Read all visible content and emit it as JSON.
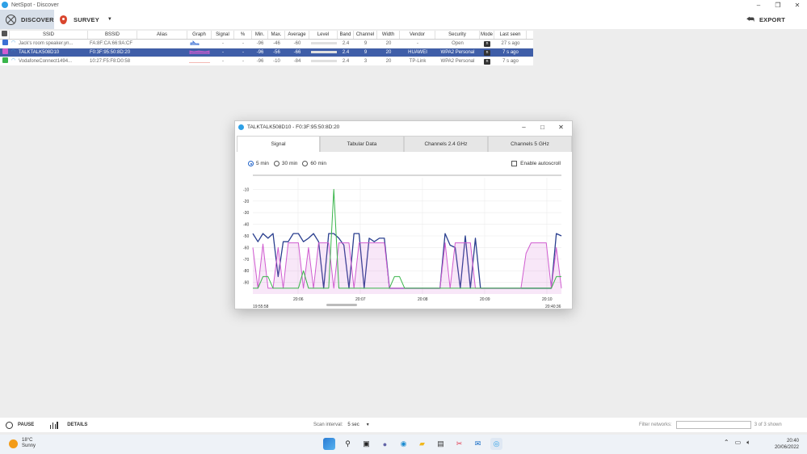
{
  "window": {
    "title": "NetSpot - Discover",
    "controls": [
      "–",
      "❐",
      "✕"
    ]
  },
  "toolbar": {
    "discover_label": "DISCOVER",
    "survey_label": "SURVEY",
    "export_label": "EXPORT"
  },
  "table": {
    "columns": [
      "SSID",
      "BSSID",
      "Alias",
      "Graph",
      "Signal",
      "%",
      "Min.",
      "Max.",
      "Average",
      "Level",
      "Band",
      "Channel",
      "Width",
      "Vendor",
      "Security",
      "Mode",
      "Last seen"
    ],
    "rows": [
      {
        "ssid": "Jack's room speaker.yn...",
        "bssid": "FA:8F:CA:66:9A:CF",
        "alias": "",
        "signal": "-",
        "pct": "-",
        "min": "-96",
        "max": "-46",
        "avg": "-60",
        "band": "2.4",
        "channel": "9",
        "width": "20",
        "vendor": "-",
        "security": "Open",
        "mode": "n",
        "last_seen": "27 s ago",
        "color": "#3b6fd4"
      },
      {
        "ssid": "TALKTALK508D10",
        "bssid": "F0:3F:95:50:8D:20",
        "alias": "",
        "signal": "-",
        "pct": "-",
        "min": "-96",
        "max": "-56",
        "avg": "-66",
        "band": "2.4",
        "channel": "9",
        "width": "20",
        "vendor": "HUAWEI",
        "security": "WPA2 Personal",
        "mode": "n",
        "last_seen": "7 s ago",
        "color": "#d05cd0"
      },
      {
        "ssid": "VodafoneConnect1494...",
        "bssid": "10:27:F5:F8:D0:58",
        "alias": "",
        "signal": "-",
        "pct": "-",
        "min": "-96",
        "max": "-10",
        "avg": "-84",
        "band": "2.4",
        "channel": "3",
        "width": "20",
        "vendor": "TP-Link",
        "security": "WPA2 Personal",
        "mode": "n",
        "last_seen": "7 s ago",
        "color": "#39b54a"
      }
    ]
  },
  "dialog": {
    "title": "TALKTALK508D10 - F0:3F:95:50:8D:20",
    "tabs": [
      "Signal",
      "Tabular Data",
      "Channels 2.4 GHz",
      "Channels 5 GHz"
    ],
    "ranges": [
      "5 min",
      "30 min",
      "60 min"
    ],
    "autoscroll_label": "Enable autoscroll"
  },
  "chart_data": {
    "type": "line",
    "y_ticks": [
      "-10",
      "-20",
      "-30",
      "-40",
      "-50",
      "-60",
      "-70",
      "-80",
      "-90"
    ],
    "ylim": [
      -100,
      0
    ],
    "x_ticks": [
      "20:06",
      "20:07",
      "20:08",
      "20:09",
      "20:10"
    ],
    "x_start": "19:55:58",
    "x_end": "20:40:36",
    "series": [
      {
        "color": "#2a3f8f",
        "fill": false,
        "values": [
          -48,
          -55,
          -48,
          -52,
          -48,
          -85,
          -55,
          -55,
          -48,
          -48,
          -55,
          -52,
          -48,
          -55,
          -95,
          -48,
          -48,
          -52,
          -58,
          -95,
          -48,
          -48,
          -95,
          -52,
          -55,
          -52,
          -52,
          -95,
          -95,
          -95,
          -95,
          -95,
          -95,
          -95,
          -95,
          -95,
          -95,
          -95,
          -48,
          -58,
          -60,
          -95,
          -50,
          -95,
          -52,
          -95,
          -95,
          -95,
          -95,
          -95,
          -95,
          -95,
          -95,
          -95,
          -95,
          -95,
          -95,
          -95,
          -95,
          -95,
          -48,
          -50
        ]
      },
      {
        "color": "#d05cd0",
        "fill": true,
        "values": [
          -60,
          -95,
          -57,
          -95,
          -95,
          -60,
          -95,
          -56,
          -56,
          -56,
          -95,
          -60,
          -95,
          -56,
          -56,
          -56,
          -95,
          -56,
          -56,
          -56,
          -95,
          -56,
          -56,
          -56,
          -56,
          -56,
          -56,
          -95,
          -95,
          -95,
          -95,
          -95,
          -95,
          -95,
          -95,
          -95,
          -95,
          -95,
          -56,
          -95,
          -56,
          -56,
          -56,
          -56,
          -95,
          -95,
          -95,
          -95,
          -95,
          -95,
          -95,
          -95,
          -95,
          -95,
          -65,
          -56,
          -56,
          -56,
          -56,
          -95,
          -60,
          -95
        ]
      },
      {
        "color": "#39b54a",
        "fill": false,
        "values": [
          -95,
          -95,
          -85,
          -85,
          -95,
          -95,
          -95,
          -95,
          -95,
          -95,
          -80,
          -95,
          -95,
          -95,
          -95,
          -95,
          -10,
          -95,
          -95,
          -95,
          -95,
          -95,
          -95,
          -95,
          -95,
          -95,
          -95,
          -95,
          -85,
          -85,
          -95,
          -95,
          -95,
          -95,
          -95,
          -95,
          -95,
          -95,
          -95,
          -95,
          -95,
          -95,
          -95,
          -95,
          -95,
          -95,
          -95,
          -95,
          -95,
          -95,
          -95,
          -95,
          -95,
          -95,
          -95,
          -95,
          -95,
          -95,
          -95,
          -95,
          -85,
          -85
        ]
      }
    ]
  },
  "statusbar": {
    "pause_label": "PAUSE",
    "details_label": "DETAILS",
    "scan_label": "Scan interval:",
    "scan_value": "5 sec",
    "filter_label": "Filter networks:",
    "filter_value": "",
    "count": "3 of 3 shown"
  },
  "taskbar": {
    "temp": "18°C",
    "weather": "Sunny",
    "time": "20:40",
    "date": "20/06/2022"
  }
}
